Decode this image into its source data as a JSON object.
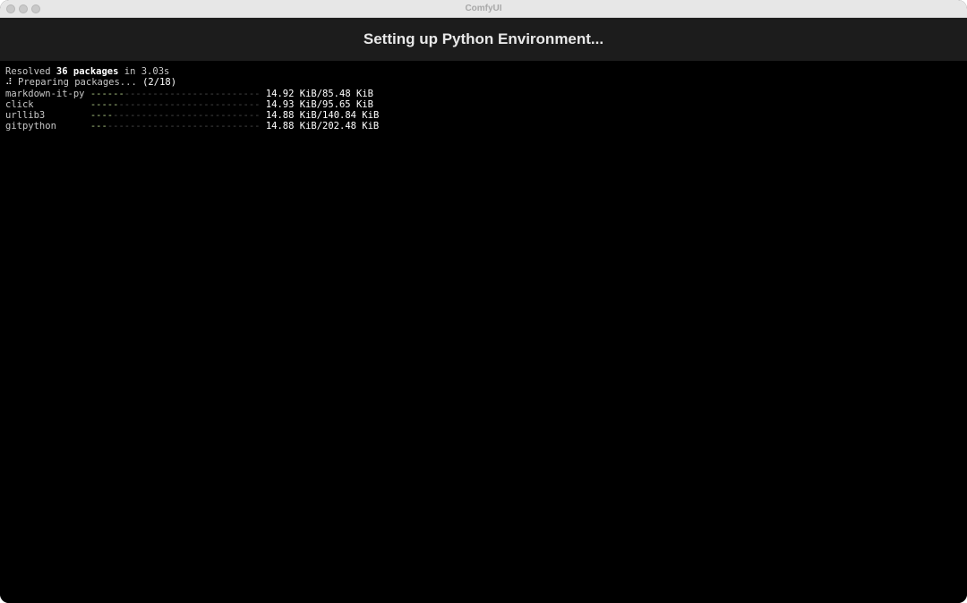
{
  "window": {
    "title": "ComfyUI"
  },
  "header": {
    "title": "Setting up Python Environment..."
  },
  "terminal": {
    "resolved": {
      "prefix": "Resolved ",
      "count": "36 packages",
      "suffix": " in 3.03s"
    },
    "preparing": {
      "spinner": "⠼",
      "text": " Preparing packages... ",
      "progress": "(2/18)"
    },
    "downloads": [
      {
        "name": "markdown-it-py",
        "pad": " ",
        "bar_done": "------",
        "bar_rest": "------------------------",
        "size": " 14.92 KiB/85.48 KiB",
        "progress_fraction": 0.1745
      },
      {
        "name": "click",
        "pad": "          ",
        "bar_done": "-----",
        "bar_rest": "-------------------------",
        "size": " 14.93 KiB/95.65 KiB",
        "progress_fraction": 0.1561
      },
      {
        "name": "urllib3",
        "pad": "        ",
        "bar_done": "----",
        "bar_rest": "--------------------------",
        "size": " 14.88 KiB/140.84 KiB",
        "progress_fraction": 0.1057
      },
      {
        "name": "gitpython",
        "pad": "      ",
        "bar_done": "---",
        "bar_rest": "---------------------------",
        "size": " 14.88 KiB/202.48 KiB",
        "progress_fraction": 0.0735
      }
    ]
  }
}
